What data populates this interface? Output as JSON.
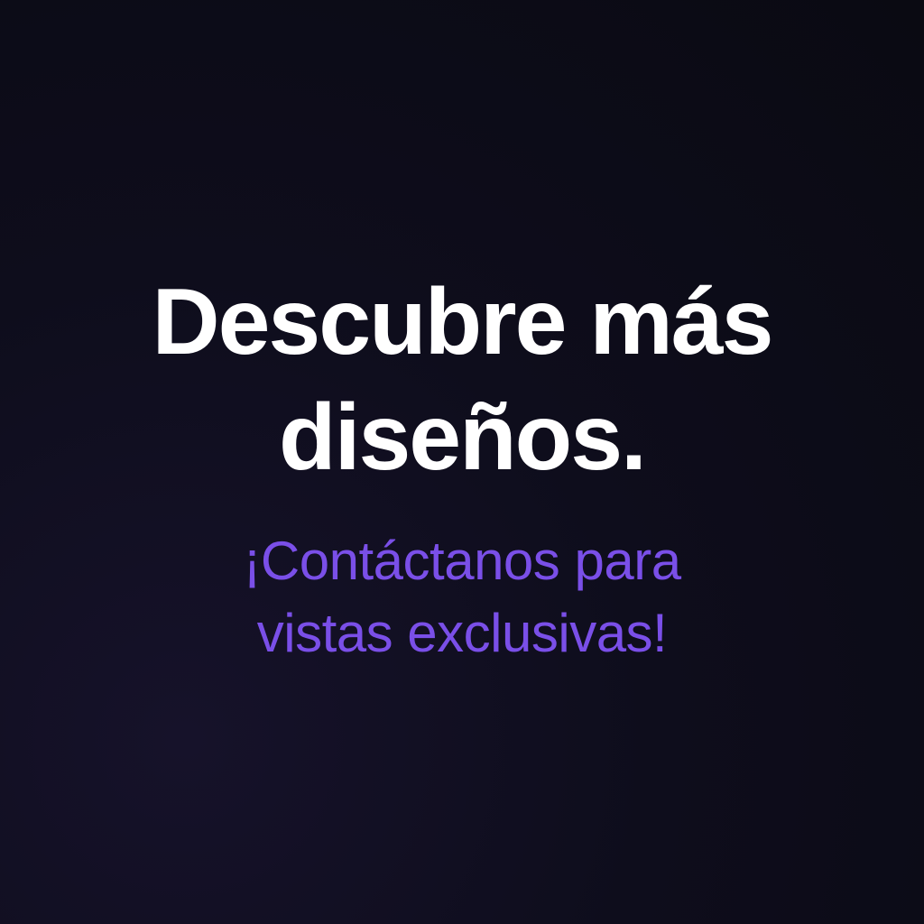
{
  "colors": {
    "background": "#0e0d1c",
    "headline": "#ffffff",
    "accent": "#7a4fe8"
  },
  "headline": {
    "line1": "Descubre más",
    "line2": "diseños."
  },
  "subline": {
    "line1": "¡Contáctanos para",
    "line2": "vistas exclusivas!"
  }
}
